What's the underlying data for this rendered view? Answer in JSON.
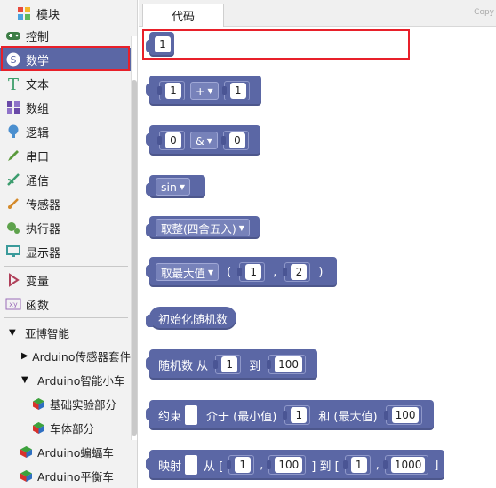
{
  "sidebar": {
    "header": {
      "label": "模块"
    },
    "categories": [
      {
        "label": "控制",
        "icon": "gamepad-icon"
      },
      {
        "label": "数学",
        "icon": "math-icon"
      },
      {
        "label": "文本",
        "icon": "text-t-icon"
      },
      {
        "label": "数组",
        "icon": "array-blocks-icon"
      },
      {
        "label": "逻辑",
        "icon": "bulb-icon"
      },
      {
        "label": "串口",
        "icon": "pen-icon"
      },
      {
        "label": "通信",
        "icon": "signal-icon"
      },
      {
        "label": "传感器",
        "icon": "sensor-icon"
      },
      {
        "label": "执行器",
        "icon": "actuator-icon"
      },
      {
        "label": "显示器",
        "icon": "monitor-icon"
      },
      {
        "label": "变量",
        "icon": "variable-icon"
      },
      {
        "label": "函数",
        "icon": "function-icon"
      }
    ],
    "tree": [
      {
        "label": "亚博智能",
        "arrow": "▼"
      },
      {
        "label": "Arduino传感器套件",
        "arrow": "▶"
      },
      {
        "label": "Arduino智能小车",
        "arrow": "▼"
      },
      {
        "label": "基础实验部分"
      },
      {
        "label": "车体部分"
      },
      {
        "label": "Arduino蝙蝠车"
      },
      {
        "label": "Arduino平衡车"
      }
    ]
  },
  "tab": {
    "label": "代码",
    "brand": "Copy"
  },
  "blocks": {
    "number": {
      "value": "1"
    },
    "arith": {
      "a": "1",
      "op": "+",
      "b": "1"
    },
    "bitwise": {
      "a": "0",
      "op": "&",
      "b": "0"
    },
    "trig": {
      "fn": "sin"
    },
    "round": {
      "fn": "取整(四舍五入)"
    },
    "maxof": {
      "fn": "取最大值",
      "open": "(",
      "a": "1",
      "comma": ",",
      "b": "2",
      "close": ")"
    },
    "seed": {
      "label": "初始化随机数"
    },
    "random": {
      "label": "随机数 从",
      "a": "1",
      "to": "到",
      "b": "100"
    },
    "constrain": {
      "label": "约束",
      "between": "介于 (最小值)",
      "a": "1",
      "and": "和 (最大值)",
      "b": "100"
    },
    "map": {
      "label": "映射",
      "from": "从 [",
      "a": "1",
      "comma1": ",",
      "b": "100",
      "to": "] 到 [",
      "c": "1",
      "comma2": ",",
      "d": "1000",
      "close": "]"
    }
  }
}
